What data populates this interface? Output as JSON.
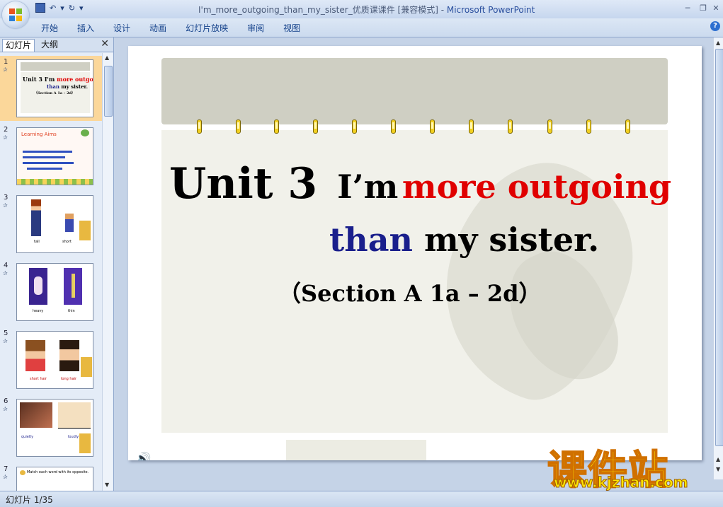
{
  "window": {
    "title": "I'm_more_outgoing_than_my_sister_优质课课件 [兼容模式]",
    "app": "Microsoft PowerPoint",
    "separator": " - "
  },
  "ribbon": {
    "tabs": [
      "开始",
      "插入",
      "设计",
      "动画",
      "幻灯片放映",
      "审阅",
      "视图"
    ]
  },
  "pane": {
    "tab_slides": "幻灯片",
    "tab_outline": "大纲",
    "close": "✕"
  },
  "thumbnails": [
    {
      "num": "1",
      "line1a": "Unit 3",
      "line1b": "I'm",
      "line1c": "more outgoing",
      "line2a": "than",
      "line2b": "my sister.",
      "line3": "（Section A 1a – 2d）"
    },
    {
      "num": "2",
      "heading": "Learning Aims"
    },
    {
      "num": "3",
      "caption1": "tall",
      "caption2": "short"
    },
    {
      "num": "4",
      "caption1": "heavy",
      "caption2": "thin"
    },
    {
      "num": "5",
      "caption1": "short hair",
      "caption2": "long hair"
    },
    {
      "num": "6",
      "caption1": "quietly",
      "caption2": "loudly"
    },
    {
      "num": "7",
      "heading": "Match each word with its opposite."
    }
  ],
  "slide": {
    "unit": "Unit 3",
    "im": "I’m",
    "more_outgoing": "more outgoing",
    "than": "than",
    "my_sister": "my sister.",
    "section": "（Section A  1a – 2d）"
  },
  "status": {
    "slide_count": "幻灯片 1/35"
  },
  "watermark": {
    "cn": "课件站",
    "url": "www.kjzhan.com"
  },
  "colors": {
    "accent_red": "#e00000",
    "accent_blue": "#1a1f8c",
    "ribbon": "#dce7f5"
  }
}
